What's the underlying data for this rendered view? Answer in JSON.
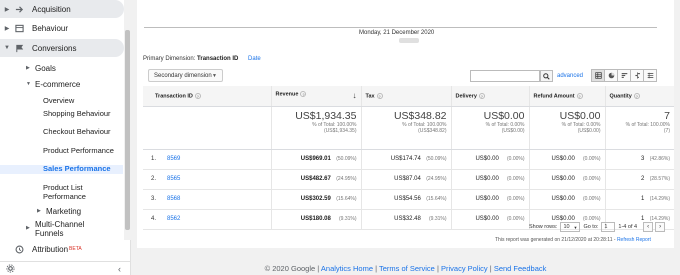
{
  "sidebar": {
    "acquisition": "Acquisition",
    "behaviour": "Behaviour",
    "conversions": "Conversions",
    "goals": "Goals",
    "ecommerce": "E-commerce",
    "overview": "Overview",
    "shopping_behaviour": "Shopping Behaviour",
    "checkout_behaviour": "Checkout Behaviour",
    "product_performance": "Product Performance",
    "sales_performance": "Sales Performance",
    "product_list_performance": "Product List Performance",
    "marketing": "Marketing",
    "multichannel_funnels": "Multi-Channel Funnels",
    "attribution": "Attribution",
    "attribution_badge": "BETA"
  },
  "chart": {
    "date_label": "Monday, 21 December 2020"
  },
  "toolbar": {
    "primary_dimension_label": "Primary Dimension:",
    "primary_dimension_value": "Transaction ID",
    "date_link": "Date",
    "secondary_dimension": "Secondary dimension",
    "advanced": "advanced"
  },
  "table": {
    "headers": {
      "transaction_id": "Transaction ID",
      "revenue": "Revenue",
      "tax": "Tax",
      "delivery": "Delivery",
      "refund_amount": "Refund Amount",
      "quantity": "Quantity"
    },
    "totals": {
      "revenue": "US$1,934.35",
      "revenue_sub1": "% of Total: 100.00%",
      "revenue_sub2": "(US$1,934.35)",
      "tax": "US$348.82",
      "tax_sub1": "% of Total: 100.00%",
      "tax_sub2": "(US$348.82)",
      "delivery": "US$0.00",
      "delivery_sub1": "% of Total: 0.00%",
      "delivery_sub2": "(US$0.00)",
      "refund": "US$0.00",
      "refund_sub1": "% of Total: 0.00%",
      "refund_sub2": "(US$0.00)",
      "quantity": "7",
      "quantity_sub1": "% of Total: 100.00%",
      "quantity_sub2": "(7)"
    },
    "rows": [
      {
        "index": "1.",
        "id": "8569",
        "revenue": "US$969.01",
        "revenue_pct": "(50.09%)",
        "tax": "US$174.74",
        "tax_pct": "(50.09%)",
        "delivery": "US$0.00",
        "delivery_pct": "(0.00%)",
        "refund": "US$0.00",
        "refund_pct": "(0.00%)",
        "quantity": "3",
        "quantity_pct": "(42.86%)"
      },
      {
        "index": "2.",
        "id": "8565",
        "revenue": "US$482.67",
        "revenue_pct": "(24.95%)",
        "tax": "US$87.04",
        "tax_pct": "(24.95%)",
        "delivery": "US$0.00",
        "delivery_pct": "(0.00%)",
        "refund": "US$0.00",
        "refund_pct": "(0.00%)",
        "quantity": "2",
        "quantity_pct": "(28.57%)"
      },
      {
        "index": "3.",
        "id": "8568",
        "revenue": "US$302.59",
        "revenue_pct": "(15.64%)",
        "tax": "US$54.56",
        "tax_pct": "(15.64%)",
        "delivery": "US$0.00",
        "delivery_pct": "(0.00%)",
        "refund": "US$0.00",
        "refund_pct": "(0.00%)",
        "quantity": "1",
        "quantity_pct": "(14.29%)"
      },
      {
        "index": "4.",
        "id": "8562",
        "revenue": "US$180.08",
        "revenue_pct": "(9.31%)",
        "tax": "US$32.48",
        "tax_pct": "(9.31%)",
        "delivery": "US$0.00",
        "delivery_pct": "(0.00%)",
        "refund": "US$0.00",
        "refund_pct": "(0.00%)",
        "quantity": "1",
        "quantity_pct": "(14.29%)"
      }
    ]
  },
  "pagination": {
    "show_rows_label": "Show rows:",
    "show_rows_value": "10",
    "goto_label": "Go to:",
    "goto_value": "1",
    "range": "1-4 of 4"
  },
  "report_note": {
    "text": "This report was generated on 21/12/2020 at 20:28:11 -",
    "refresh": "Refresh Report"
  },
  "footer": {
    "copyright": "© 2020 Google |",
    "analytics_home": "Analytics Home",
    "terms": "Terms of Service",
    "privacy": "Privacy Policy",
    "feedback": "Send Feedback",
    "sep": "|"
  }
}
